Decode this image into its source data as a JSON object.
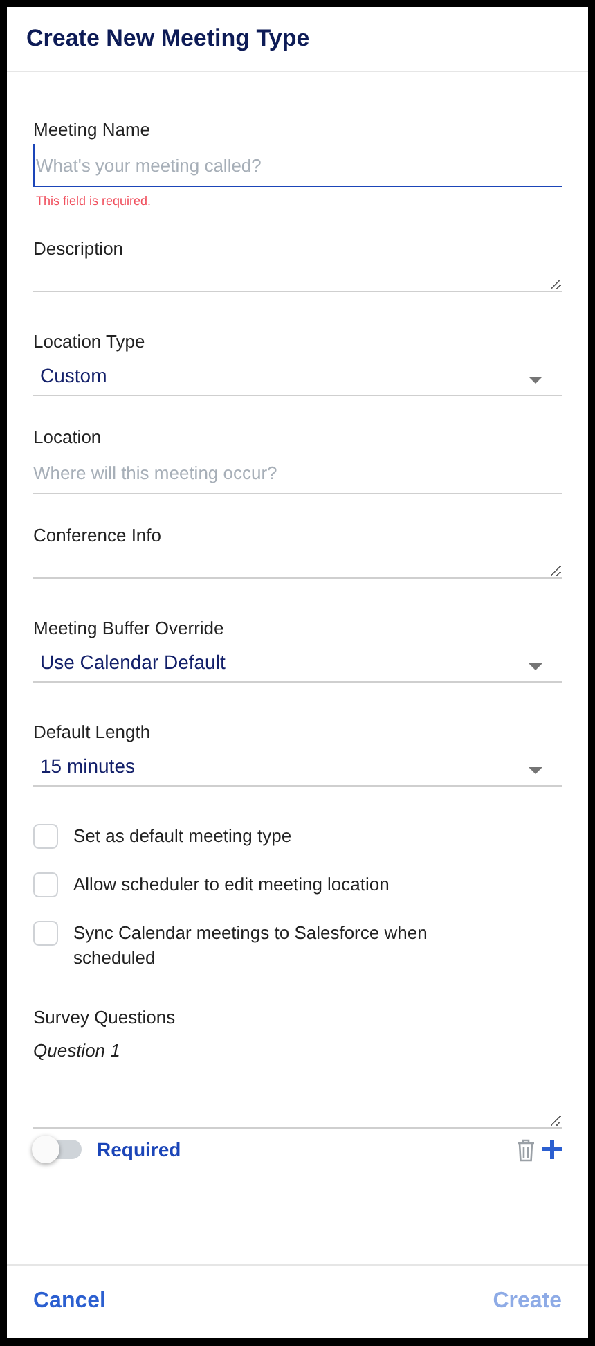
{
  "dialog": {
    "title": "Create New Meeting Type"
  },
  "fields": [
    {
      "kind": "text",
      "label": "Meeting Name",
      "placeholder": "What's your meeting called?",
      "focused": true,
      "error": "This field is required."
    },
    {
      "kind": "textarea",
      "label": "Description"
    },
    {
      "kind": "select",
      "label": "Location Type",
      "value": "Custom"
    },
    {
      "kind": "text",
      "label": "Location",
      "placeholder": "Where will this meeting occur?",
      "focused": false
    },
    {
      "kind": "textarea",
      "label": "Conference Info"
    },
    {
      "kind": "select",
      "label": "Meeting Buffer Override",
      "value": "Use Calendar Default"
    },
    {
      "kind": "select",
      "label": "Default Length",
      "value": "15 minutes"
    }
  ],
  "checkboxes": [
    {
      "label": "Set as default meeting type",
      "checked": false
    },
    {
      "label": "Allow scheduler to edit meeting location",
      "checked": false
    },
    {
      "label": "Sync Calendar meetings to Salesforce when scheduled",
      "checked": false
    }
  ],
  "survey": {
    "title": "Survey Questions",
    "question_label": "Question 1",
    "required_label": "Required",
    "required_on": false
  },
  "footer": {
    "cancel": "Cancel",
    "create": "Create",
    "create_disabled": true
  }
}
